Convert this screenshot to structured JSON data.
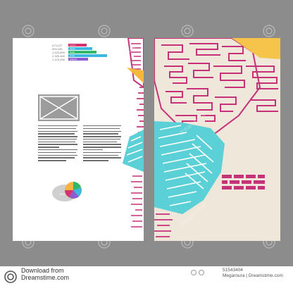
{
  "stats": [
    "673,227",
    "909,435",
    "1,325,855",
    "2,345,468",
    "1,123,256"
  ],
  "bar_labels": [
    "Lorem",
    "Ipsum",
    "Dolor",
    "Amet",
    "Adipisci"
  ],
  "bar_colors": [
    "#d6306e",
    "#3cb7e0",
    "#2fb86a",
    "#f3a94a",
    "#8a5bd1"
  ],
  "pie_label": "15%",
  "watermark": "dreamstime",
  "footer": {
    "download_line1": "Download from",
    "download_line2": "Dreamstime.com",
    "id": "51543404",
    "credit": "Megaroura | Dreamstime.com"
  }
}
